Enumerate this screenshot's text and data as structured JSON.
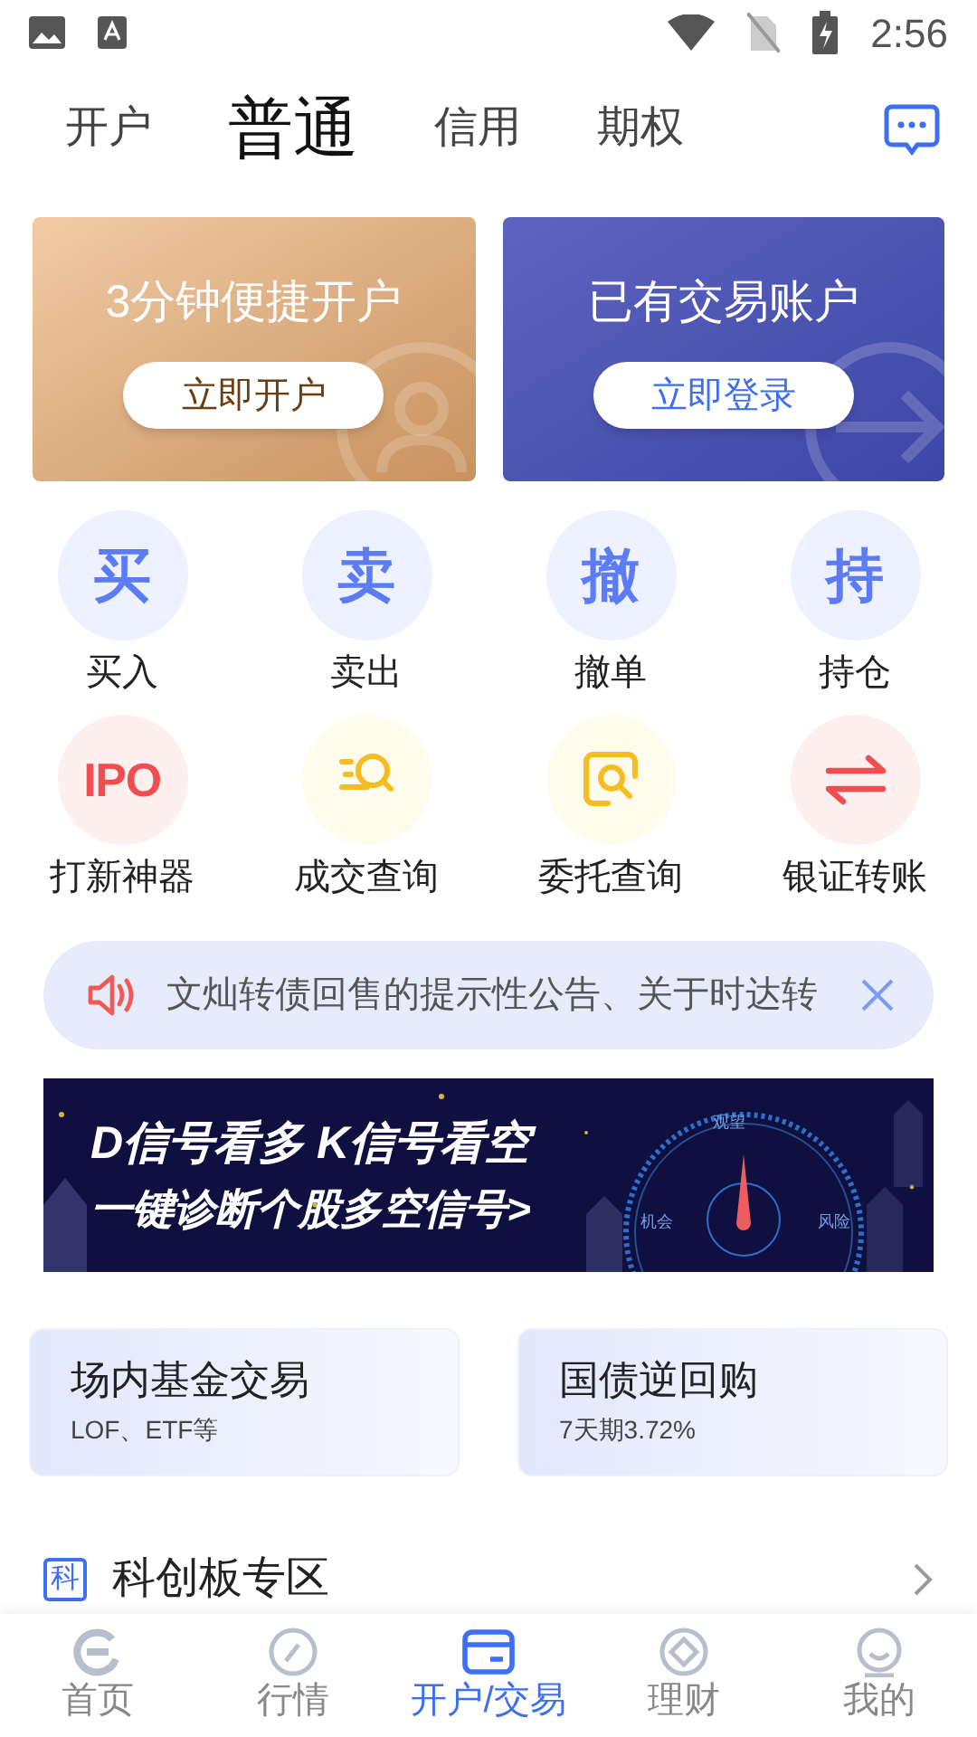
{
  "status_bar": {
    "time": "2:56"
  },
  "tabs": [
    {
      "label": "开户",
      "selected": false
    },
    {
      "label": "普通",
      "selected": true
    },
    {
      "label": "信用",
      "selected": false
    },
    {
      "label": "期权",
      "selected": false
    }
  ],
  "promo_cards": [
    {
      "kind": "open",
      "title": "3分钟便捷开户",
      "button": "立即开户"
    },
    {
      "kind": "login",
      "title": "已有交易账户",
      "button": "立即登录"
    }
  ],
  "functions": [
    {
      "kind": "glyph",
      "glyph": "买",
      "label": "买入",
      "color": "#5b7cf6"
    },
    {
      "kind": "glyph",
      "glyph": "卖",
      "label": "卖出",
      "color": "#5b7cf6"
    },
    {
      "kind": "glyph",
      "glyph": "撤",
      "label": "撤单",
      "color": "#5b7cf6"
    },
    {
      "kind": "glyph",
      "glyph": "持",
      "label": "持仓",
      "color": "#5b7cf6"
    },
    {
      "kind": "glyph",
      "glyph": "IPO",
      "label": "打新神器",
      "color": "#f04e50"
    },
    {
      "kind": "search-list",
      "label": "成交查询",
      "color": "#f5bd21"
    },
    {
      "kind": "search-doc",
      "label": "委托查询",
      "color": "#f5bd21"
    },
    {
      "kind": "transfer",
      "label": "银证转账",
      "color": "#f04e50"
    }
  ],
  "notice": {
    "text": "文灿转债回售的提示性公告、关于时达转"
  },
  "banner": {
    "headline": "D信号看多 K信号看空",
    "subline": "一键诊断个股多空信号>",
    "gauge_labels": [
      "观望",
      "机会",
      "风险"
    ]
  },
  "quick_cards": [
    {
      "title": "场内基金交易",
      "subtitle": "LOF、ETF等"
    },
    {
      "title": "国债逆回购",
      "subtitle": "7天期3.72%"
    }
  ],
  "section": {
    "badge": "科",
    "title": "科创板专区"
  },
  "bottom_nav": [
    {
      "label": "首页",
      "selected": false,
      "kind": "home"
    },
    {
      "label": "行情",
      "selected": false,
      "kind": "market"
    },
    {
      "label": "开户/交易",
      "selected": true,
      "kind": "trade"
    },
    {
      "label": "理财",
      "selected": false,
      "kind": "wealth"
    },
    {
      "label": "我的",
      "selected": false,
      "kind": "me"
    }
  ]
}
